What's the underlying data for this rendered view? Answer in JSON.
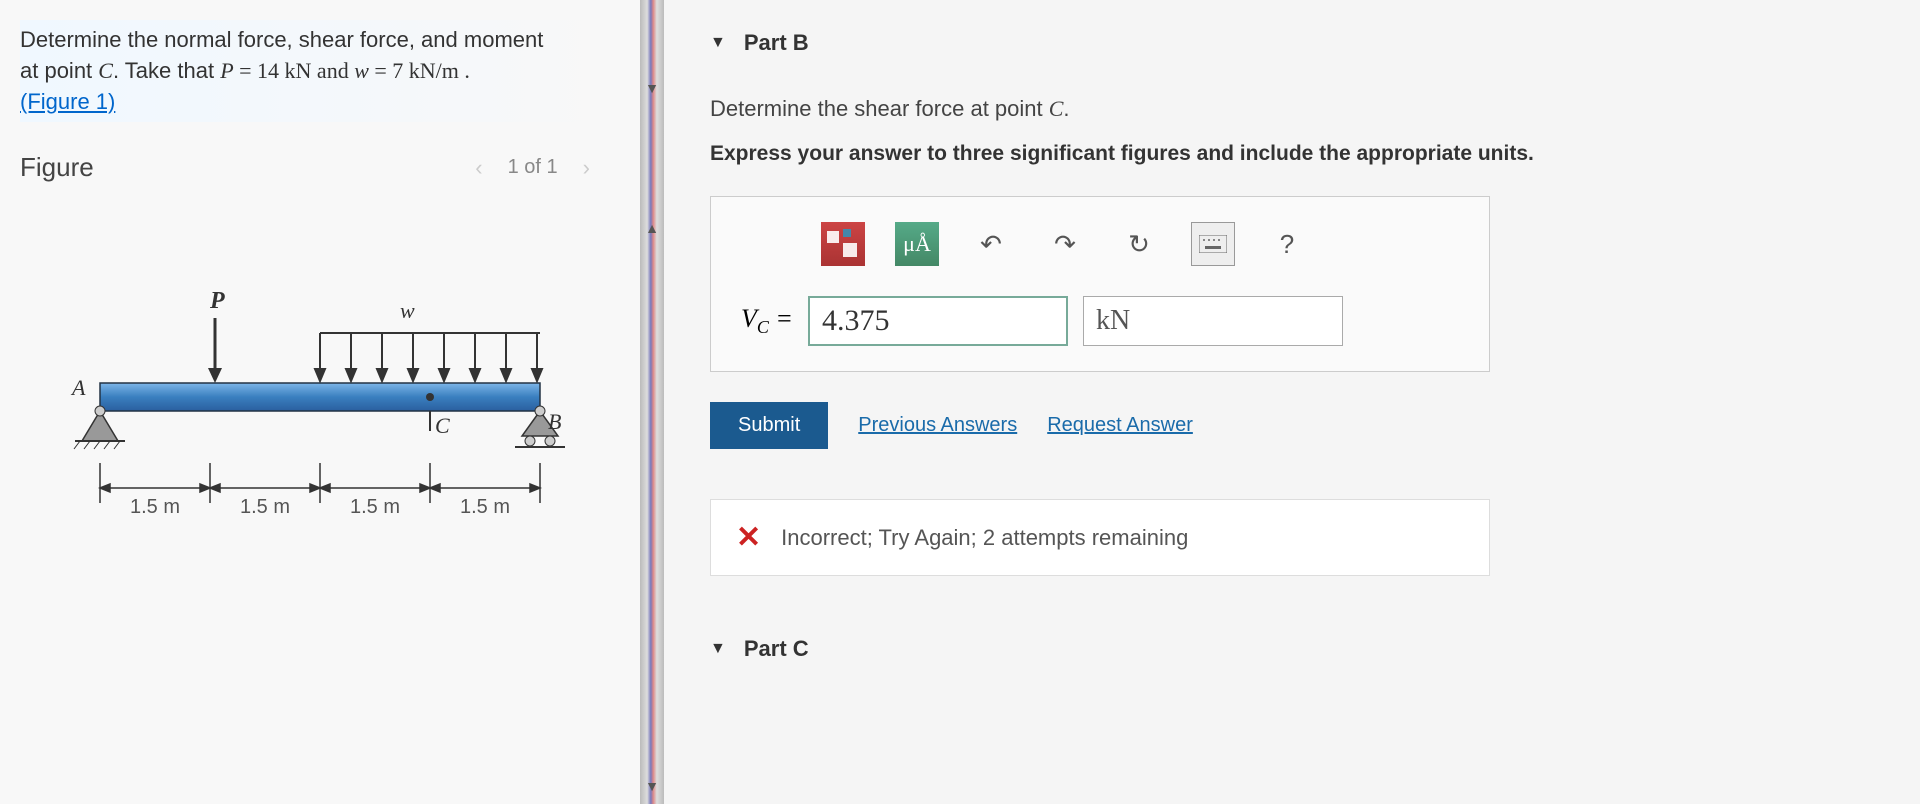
{
  "problem": {
    "line1a": "Determine the normal force, shear force, and moment",
    "line2a": "at point ",
    "line2b": "C",
    "line2c": ". Take that ",
    "line2d": "P",
    "line2e": " = 14 kN and ",
    "line2f": "w",
    "line2g": " = 7 kN/m .",
    "figlink": "(Figure 1)"
  },
  "figure": {
    "title": "Figure",
    "pager": "1 of 1",
    "labels": {
      "P": "P",
      "w": "w",
      "A": "A",
      "B": "B",
      "C": "C",
      "dim": "1.5 m"
    }
  },
  "partB": {
    "title": "Part B",
    "question_a": "Determine the shear force at point ",
    "question_b": "C",
    "question_c": ".",
    "instruction": "Express your answer to three significant figures and include the appropriate units.",
    "toolbar": {
      "units": "μÅ",
      "help": "?"
    },
    "var_main": "V",
    "var_sub": "C",
    "equals": " = ",
    "value": "4.375",
    "unit": "kN",
    "submit": "Submit",
    "prev": "Previous Answers",
    "req": "Request Answer",
    "feedback": "Incorrect; Try Again; 2 attempts remaining"
  },
  "partC": {
    "title": "Part C"
  }
}
